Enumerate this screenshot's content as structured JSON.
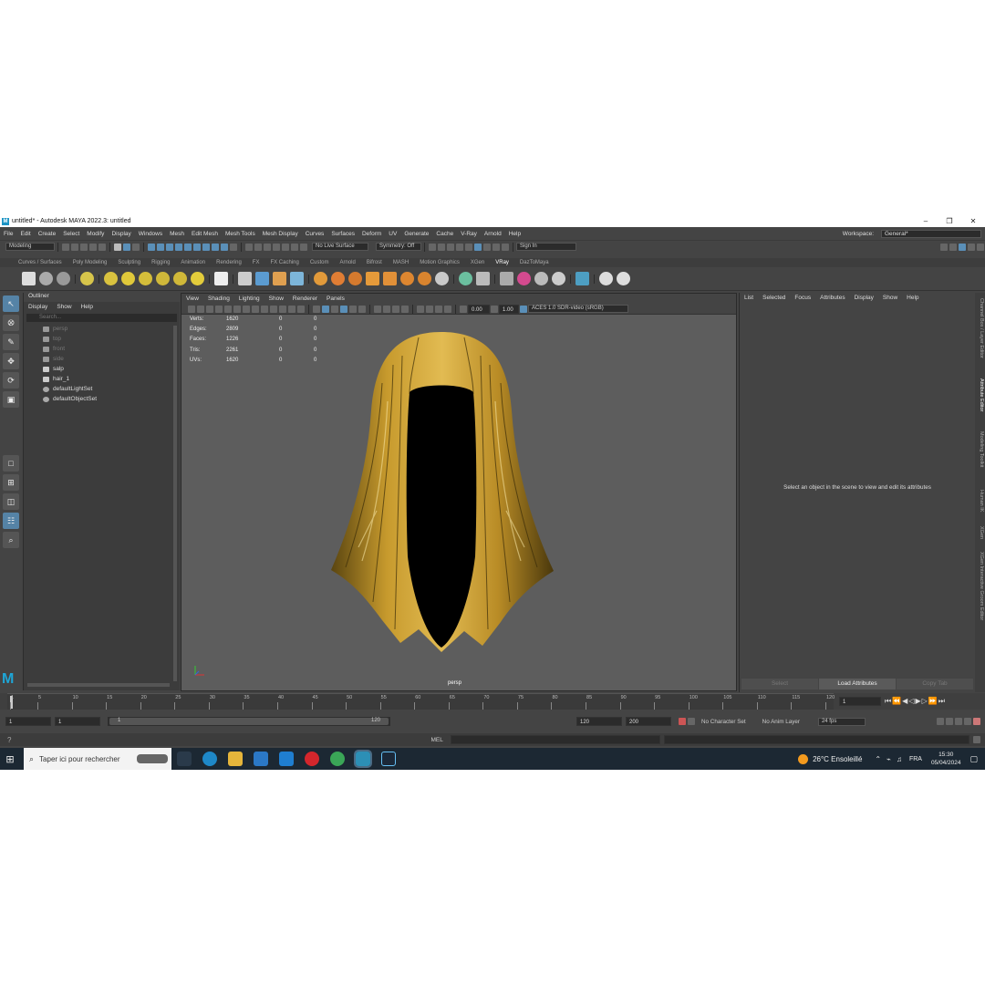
{
  "window": {
    "title": "untitled* - Autodesk MAYA 2022.3: untitled",
    "logo": "M",
    "min": "–",
    "restore": "❐",
    "close": "✕"
  },
  "menu": [
    "File",
    "Edit",
    "Create",
    "Select",
    "Modify",
    "Display",
    "Windows",
    "Mesh",
    "Edit Mesh",
    "Mesh Tools",
    "Mesh Display",
    "Curves",
    "Surfaces",
    "Deform",
    "UV",
    "Generate",
    "Cache",
    "V-Ray",
    "Arnold",
    "Help"
  ],
  "workspace": {
    "label": "Workspace:",
    "value": "General*"
  },
  "status": {
    "mode": "Modeling",
    "live_surface": "No Live Surface",
    "symmetry": "Symmetry: Off",
    "sign_in": "Sign In"
  },
  "shelf_tabs": [
    "Curves / Surfaces",
    "Poly Modeling",
    "Sculpting",
    "Rigging",
    "Animation",
    "Rendering",
    "FX",
    "FX Caching",
    "Custom",
    "Arnold",
    "Bifrost",
    "MASH",
    "Motion Graphics",
    "XGen",
    "VRay",
    "DazToMaya"
  ],
  "shelf_active": "VRay",
  "outliner": {
    "title": "Outliner",
    "menu": [
      "Display",
      "Show",
      "Help"
    ],
    "search": "Search...",
    "items": [
      {
        "name": "persp",
        "dim": true
      },
      {
        "name": "top",
        "dim": true
      },
      {
        "name": "front",
        "dim": true
      },
      {
        "name": "side",
        "dim": true
      },
      {
        "name": "salp",
        "dim": false
      },
      {
        "name": "hair_1",
        "dim": false
      },
      {
        "name": "defaultLightSet",
        "dim": false
      },
      {
        "name": "defaultObjectSet",
        "dim": false
      }
    ]
  },
  "viewport": {
    "menu": [
      "View",
      "Shading",
      "Lighting",
      "Show",
      "Renderer",
      "Panels"
    ],
    "exposure": "0.00",
    "gamma": "1.00",
    "colorspace": "ACES 1.0 SDR-video (sRGB)",
    "camera": "persp",
    "hud": [
      {
        "label": "Verts:",
        "v": "1620",
        "a": "0",
        "b": "0"
      },
      {
        "label": "Edges:",
        "v": "2809",
        "a": "0",
        "b": "0"
      },
      {
        "label": "Faces:",
        "v": "1226",
        "a": "0",
        "b": "0"
      },
      {
        "label": "Tris:",
        "v": "2261",
        "a": "0",
        "b": "0"
      },
      {
        "label": "UVs:",
        "v": "1620",
        "a": "0",
        "b": "0"
      }
    ]
  },
  "attribute_editor": {
    "menu": [
      "List",
      "Selected",
      "Focus",
      "Attributes",
      "Display",
      "Show",
      "Help"
    ],
    "message": "Select an object in the scene to view and edit its attributes",
    "buttons": [
      "Select",
      "Load Attributes",
      "Copy Tab"
    ]
  },
  "side_tabs": [
    "Channel Box / Layer Editor",
    "Attribute Editor",
    "Modeling Toolkit",
    "Human IK",
    "XGen",
    "XGen Interactive Groom Editor"
  ],
  "timeline": {
    "ticks": [
      "1",
      "5",
      "10",
      "15",
      "20",
      "25",
      "30",
      "35",
      "40",
      "45",
      "50",
      "55",
      "60",
      "65",
      "70",
      "75",
      "80",
      "85",
      "90",
      "95",
      "100",
      "105",
      "110",
      "115",
      "120"
    ],
    "current": "1"
  },
  "range": {
    "start": "1",
    "playback_start": "1",
    "slider_start": "1",
    "slider_end": "120",
    "playback_end": "120",
    "end": "200",
    "char_set": "No Character Set",
    "anim_layer": "No Anim Layer",
    "fps": "24 fps"
  },
  "cmd": {
    "lang": "MEL"
  },
  "taskbar": {
    "search": "Taper ici pour rechercher",
    "weather": "26°C  Ensoleillé",
    "lang": "FRA",
    "time": "15:30",
    "date": "05/04/2024",
    "start": "⊞",
    "chat": "▢"
  },
  "colors": {
    "accent": "#5583a6",
    "hair": "#b8922a",
    "viewport_bg": "#5d5d5d",
    "maya_blue": "#1ea6d7"
  }
}
